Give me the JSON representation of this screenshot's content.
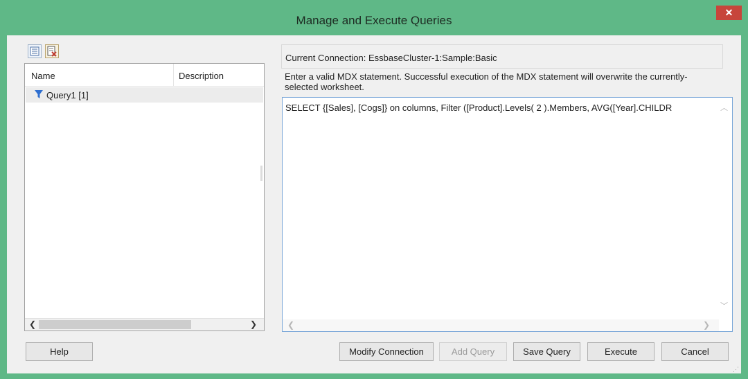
{
  "window": {
    "title": "Manage and Execute Queries",
    "close_label": "✕"
  },
  "toolbar": {
    "icons": [
      "query-list-icon",
      "delete-query-icon"
    ]
  },
  "query_list": {
    "columns": [
      "Name",
      "Description"
    ],
    "rows": [
      {
        "icon": "filter-icon",
        "name": "Query1 [1]",
        "description": ""
      }
    ]
  },
  "connection": {
    "label": "Current Connection: EssbaseCluster-1:Sample:Basic"
  },
  "instructions": "Enter a valid MDX statement. Successful execution of the MDX statement will overwrite the currently-selected worksheet.",
  "mdx": {
    "statement": "SELECT {[Sales], [Cogs]} on columns, Filter ([Product].Levels( 2 ).Members, AVG([Year].CHILDR"
  },
  "buttons": {
    "help": "Help",
    "modify_connection": "Modify Connection",
    "add_query": "Add Query",
    "save_query": "Save Query",
    "execute": "Execute",
    "cancel": "Cancel"
  },
  "colors": {
    "title_bar": "#5fb887",
    "close": "#c7453b",
    "filter_icon": "#2f6fd0"
  }
}
